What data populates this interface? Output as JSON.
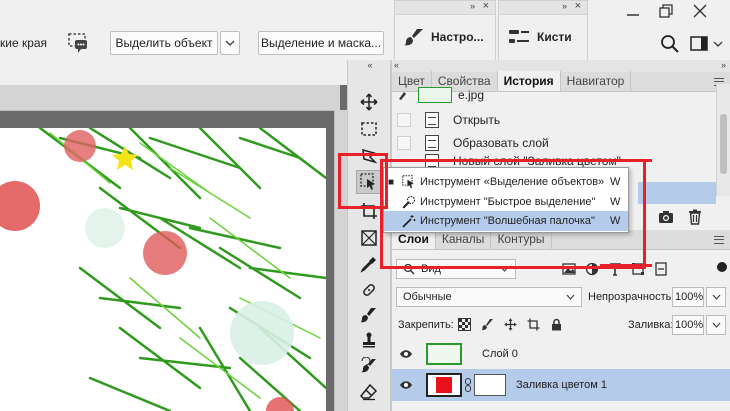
{
  "options_bar": {
    "edges_label": "кие края",
    "select_subject_label": "Выделить объект",
    "select_mask_label": "Выделение и маска..."
  },
  "floating_panels": [
    {
      "label": "Настро..."
    },
    {
      "label": "Кисти"
    }
  ],
  "tools_panel": {
    "tools": [
      "move",
      "rectangular-marquee",
      "lasso",
      "object-selection",
      "crop",
      "frame",
      "eyedropper",
      "healing-brush",
      "brush",
      "clone-stamp",
      "history-brush",
      "eraser"
    ]
  },
  "top_panel": {
    "tabs": [
      "Цвет",
      "Свойства",
      "История",
      "Навигатор"
    ],
    "active_tab": "История",
    "history": {
      "snapshot_name": "e.jpg",
      "items": [
        "Открыть",
        "Образовать слой",
        "Новый слой \"Заливка цветом\""
      ]
    }
  },
  "tool_flyout": {
    "items": [
      {
        "label": "Инструмент «Выделение объектов»",
        "shortcut": "W",
        "current": true
      },
      {
        "label": "Инструмент \"Быстрое выделение\"",
        "shortcut": "W",
        "current": false
      },
      {
        "label": "Инструмент \"Волшебная палочка\"",
        "shortcut": "W",
        "current": false
      }
    ]
  },
  "layers_panel": {
    "tabs": [
      "Слои",
      "Каналы",
      "Контуры"
    ],
    "active_tab": "Слои",
    "filter_kind": "Вид",
    "blend_mode": "Обычные",
    "opacity_label": "Непрозрачность:",
    "opacity_value": "100%",
    "lock_label": "Закрепить:",
    "fill_label": "Заливка:",
    "fill_value": "100%",
    "layers": [
      {
        "name": "Слой 0",
        "selected": false
      },
      {
        "name": "Заливка цветом 1",
        "selected": true,
        "fill_color": "#e8101a"
      }
    ]
  },
  "colors": {
    "selection_highlight": "#b5cbea",
    "annotation_red": "#e8202a"
  }
}
